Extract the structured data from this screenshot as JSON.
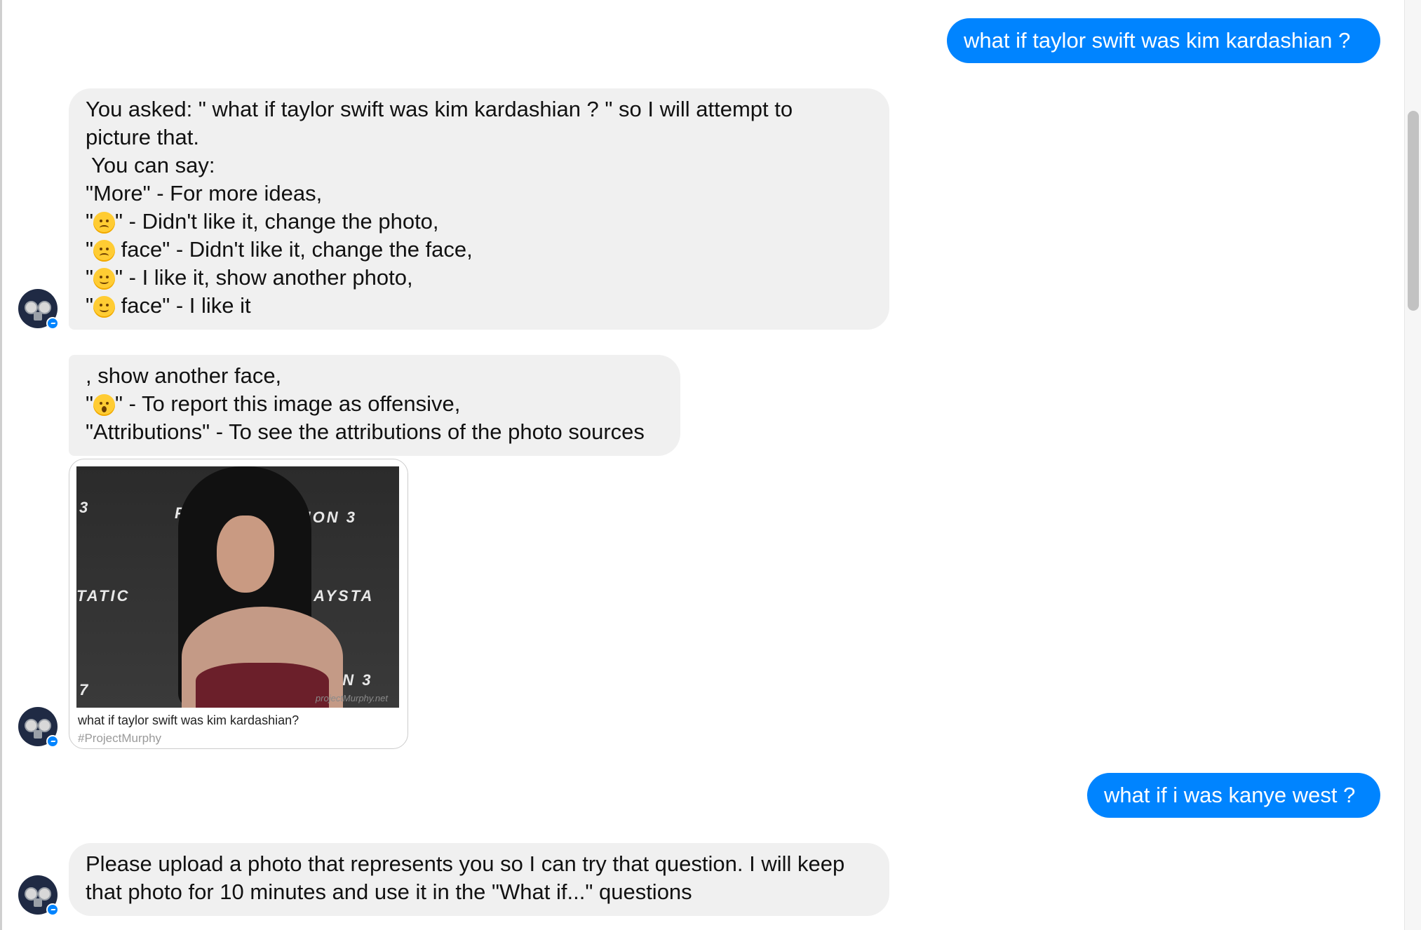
{
  "messages": [
    {
      "from": "user",
      "text": "what if taylor swift was kim kardashian ?"
    },
    {
      "from": "bot",
      "lines": [
        "You asked: \" what if taylor swift was kim kardashian ? \" so I will attempt to",
        "picture that.",
        " You can say:",
        "\"More\" - For more ideas,"
      ],
      "emoji_lines": [
        {
          "prefix": "\"",
          "emoji": "disappointed-face",
          "suffix": "\" - Didn't like it, change the photo,"
        },
        {
          "prefix": "\"",
          "emoji": "disappointed-face",
          "suffix": " face\" - Didn't like it, change the face,"
        },
        {
          "prefix": "\"",
          "emoji": "smiling-face",
          "suffix": "\" - I like it, show another photo,"
        },
        {
          "prefix": "\"",
          "emoji": "smiling-face",
          "suffix": " face\" - I like it"
        }
      ]
    },
    {
      "from": "bot",
      "line1": ", show another face,",
      "emoji_line": {
        "prefix": "\"",
        "emoji": "astonished-face",
        "suffix": "\" - To report this image as offensive,"
      },
      "line3": "\"Attributions\" - To see the attributions of the photo sources"
    },
    {
      "from": "bot",
      "card": {
        "caption": "what if taylor swift was kim kardashian?",
        "source": "#ProjectMurphy",
        "watermark": "projectMurphy.net",
        "banner_texts": [
          "3",
          "PL",
          "ITION 3",
          "TATIC",
          "PLAYSTA",
          "ION 3",
          "7"
        ]
      }
    },
    {
      "from": "user",
      "text": "what if i was kanye west ?"
    },
    {
      "from": "bot",
      "lines": [
        "Please upload a photo that represents you so I can try that question. I will keep",
        "that photo for 10 minutes and use it in the \"What if...\" questions"
      ]
    }
  ],
  "colors": {
    "outgoing_bubble": "#0084ff",
    "incoming_bubble": "#f0f0f0",
    "badge": "#0084ff"
  }
}
